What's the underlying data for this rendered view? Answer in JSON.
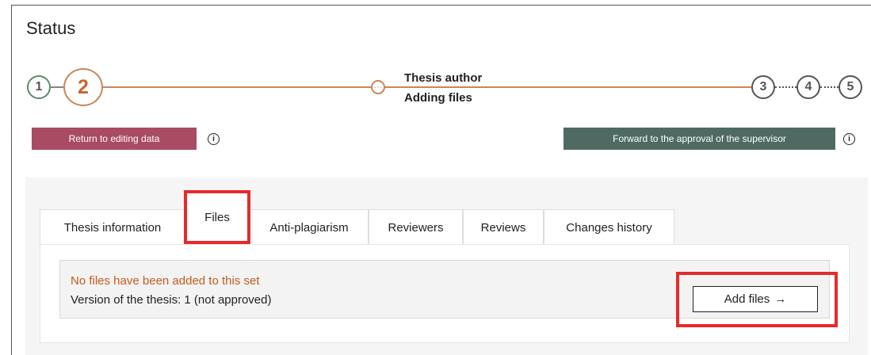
{
  "page": {
    "title": "Status"
  },
  "stepper": {
    "steps": [
      "1",
      "2",
      "3",
      "4",
      "5"
    ],
    "current_step": 2,
    "sub_marker": "···",
    "current_role": "Thesis author",
    "current_action": "Adding files",
    "colors": {
      "active": "#c8865a",
      "done": "#5c8b6d",
      "pending": "#555555"
    }
  },
  "actions": {
    "return_label": "Return to editing data",
    "forward_label": "Forward to the approval of the supervisor",
    "info_glyph": "i",
    "return_color": "#a94b63",
    "forward_color": "#4f6a62"
  },
  "tabs": [
    {
      "label": "Thesis information",
      "selected": false
    },
    {
      "label": "Files",
      "selected": true
    },
    {
      "label": "Anti-plagiarism",
      "selected": false
    },
    {
      "label": "Reviewers",
      "selected": false
    },
    {
      "label": "Reviews",
      "selected": false
    },
    {
      "label": "Changes history",
      "selected": false
    }
  ],
  "files_panel": {
    "empty_message": "No files have been added to this set",
    "version_text": "Version of the thesis: 1 (not approved)",
    "add_button_label": "Add files",
    "add_button_icon": "→"
  },
  "highlight_color": "#e52b2b"
}
